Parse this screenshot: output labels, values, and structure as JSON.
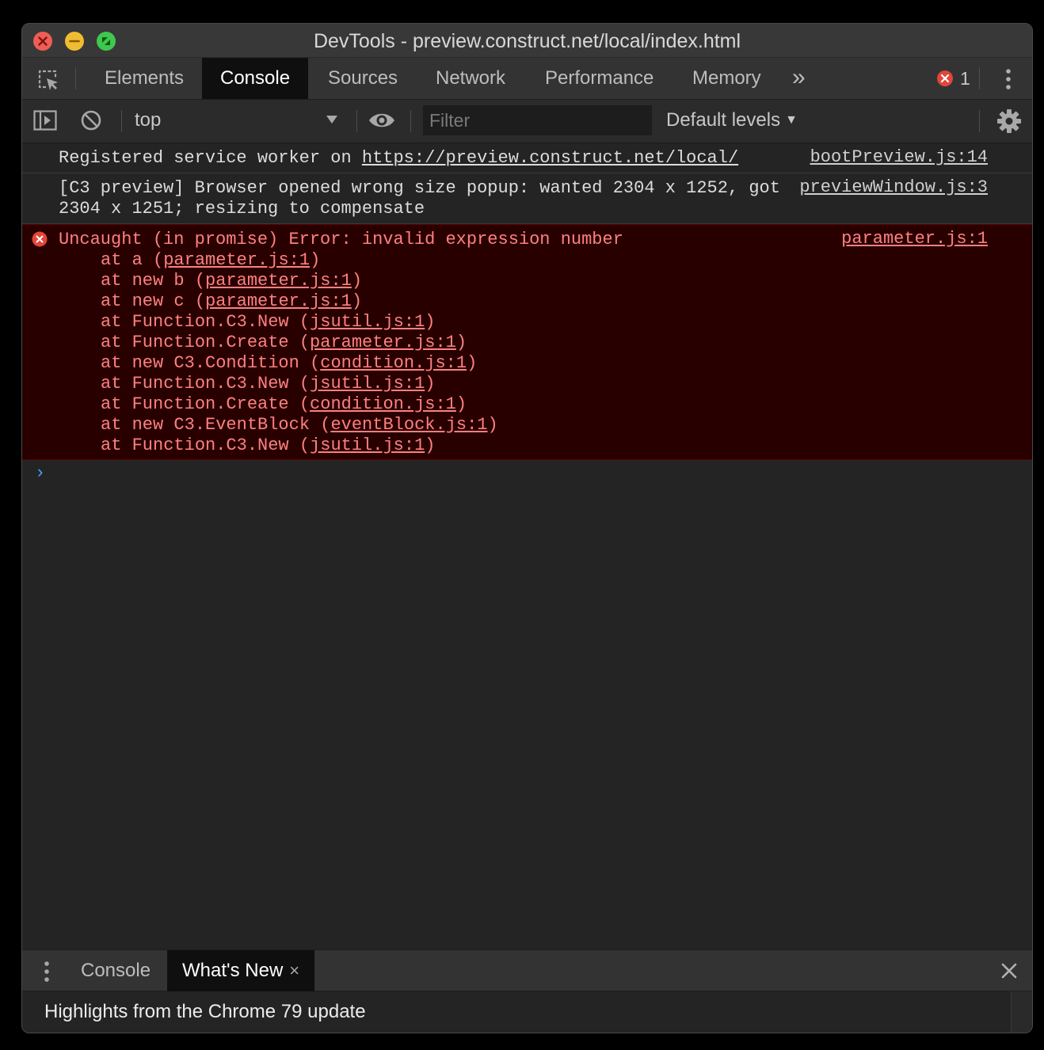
{
  "window": {
    "title": "DevTools - preview.construct.net/local/index.html"
  },
  "tabs": [
    {
      "label": "Elements",
      "active": false
    },
    {
      "label": "Console",
      "active": true
    },
    {
      "label": "Sources",
      "active": false
    },
    {
      "label": "Network",
      "active": false
    },
    {
      "label": "Performance",
      "active": false
    },
    {
      "label": "Memory",
      "active": false
    }
  ],
  "tabs_more": "»",
  "error_count": "1",
  "toolbar": {
    "context": "top",
    "filter_placeholder": "Filter",
    "levels": "Default levels",
    "levels_arrow": "▼"
  },
  "messages": {
    "m1": {
      "prefix": "Registered service worker on ",
      "url": "https://preview.construct.net/local/",
      "source": "bootPreview.js:14"
    },
    "m2": {
      "text": "[C3 preview] Browser opened wrong size popup: wanted 2304 x 1252, got 2304 x 1251; resizing to compensate",
      "source": "previewWindow.js:3"
    },
    "error": {
      "text": "Uncaught (in promise) Error: invalid expression number",
      "source": "parameter.js:1",
      "stack": [
        {
          "pre": "at a (",
          "link": "parameter.js:1",
          "post": ")"
        },
        {
          "pre": "at new b (",
          "link": "parameter.js:1",
          "post": ")"
        },
        {
          "pre": "at new c (",
          "link": "parameter.js:1",
          "post": ")"
        },
        {
          "pre": "at Function.C3.New (",
          "link": "jsutil.js:1",
          "post": ")"
        },
        {
          "pre": "at Function.Create (",
          "link": "parameter.js:1",
          "post": ")"
        },
        {
          "pre": "at new C3.Condition (",
          "link": "condition.js:1",
          "post": ")"
        },
        {
          "pre": "at Function.C3.New (",
          "link": "jsutil.js:1",
          "post": ")"
        },
        {
          "pre": "at Function.Create (",
          "link": "condition.js:1",
          "post": ")"
        },
        {
          "pre": "at new C3.EventBlock (",
          "link": "eventBlock.js:1",
          "post": ")"
        },
        {
          "pre": "at Function.C3.New (",
          "link": "jsutil.js:1",
          "post": ")"
        }
      ]
    }
  },
  "prompt": "›",
  "drawer": {
    "tabs": [
      {
        "label": "Console",
        "active": false
      },
      {
        "label": "What's New",
        "active": true,
        "close": "×"
      }
    ],
    "body_text": "Highlights from the Chrome 79 update"
  },
  "colors": {
    "error_text": "#ff8080",
    "error_bg": "#290000",
    "prompt": "#4d9bff",
    "close_red": "#ee5e55",
    "minimize_yellow": "#f0bc31",
    "zoom_green": "#3fc84d"
  },
  "icons": [
    "inspect-element-icon",
    "kebab-menu-icon",
    "sidebar-toggle-icon",
    "clear-console-icon",
    "eye-icon",
    "settings-gear-icon",
    "error-icon",
    "close-icon"
  ]
}
